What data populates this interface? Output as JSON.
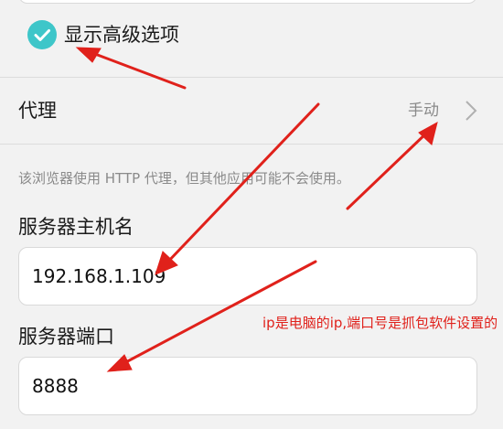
{
  "show_advanced": {
    "label": "显示高级选项",
    "checked": true,
    "color": "#3ec6c9"
  },
  "proxy": {
    "label": "代理",
    "value": "手动"
  },
  "hint_text": "该浏览器使用 HTTP 代理，但其他应用可能不会使用。",
  "host": {
    "label": "服务器主机名",
    "value": "192.168.1.109"
  },
  "port": {
    "label": "服务器端口",
    "value": "8888"
  },
  "annotation": {
    "text": "ip是电脑的ip,端口号是抓包软件设置的",
    "color": "#e0211b"
  },
  "icons": [
    "check-icon",
    "chevron-right-icon"
  ]
}
